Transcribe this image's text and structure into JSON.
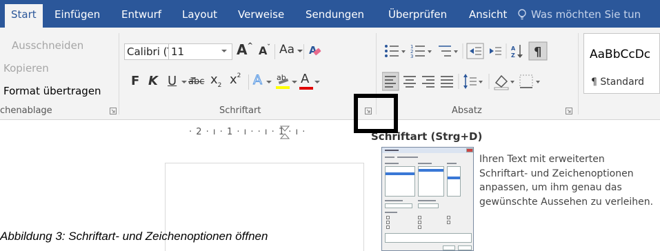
{
  "tabs": [
    "Start",
    "Einfügen",
    "Entwurf",
    "Layout",
    "Verweise",
    "Sendungen",
    "Überprüfen",
    "Ansicht"
  ],
  "tell_me": "Was möchten Sie tun",
  "clipboard": {
    "cut": "Ausschneiden",
    "copy": "Kopieren",
    "format_painter": "Format übertragen",
    "group_label": "chenablage"
  },
  "font": {
    "font_name": "Calibri (Textkö",
    "font_size": "11",
    "grow": "A",
    "shrink": "A",
    "change_case": "Aa",
    "bold": "F",
    "italic": "K",
    "underline": "U",
    "strikethrough": "abc",
    "subscript": "x",
    "superscript": "x",
    "sub_digit": "2",
    "sup_digit": "2",
    "text_effects": "A",
    "highlight": "ab",
    "font_color": "A",
    "group_label": "Schriftart"
  },
  "paragraph": {
    "group_label": "Absatz"
  },
  "styles": {
    "sample": "AaBbCcDc",
    "name": "¶ Standard"
  },
  "ruler": {
    "text": "· 2 · ı · 1 · ı ·   · ı · 1 · ı ·"
  },
  "tooltip": {
    "title": "Schriftart (Strg+D)",
    "description": "Ihren Text mit erweiterten Schriftart- und Zeichenoptionen anpassen, um ihm genau das gewünschte Aussehen zu verleihen."
  },
  "caption": "Abbildung 3: Schriftart- und Zeichenoptionen öffnen",
  "colors": {
    "ribbon_blue": "#2b579a",
    "highlight_yellow": "#ffff00",
    "font_red": "#e00000",
    "effects_blue": "#4a8fe0"
  }
}
